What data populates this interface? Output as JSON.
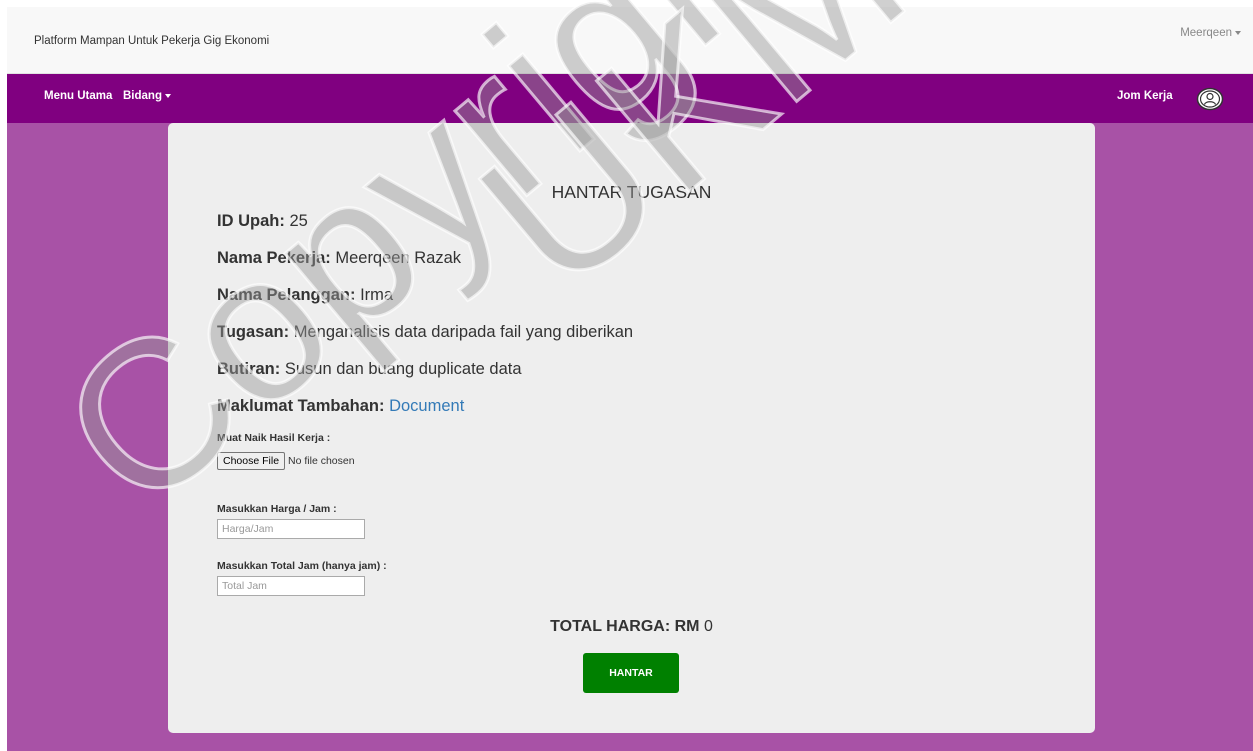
{
  "header": {
    "brand": "Platform Mampan Untuk Pekerja Gig Ekonomi",
    "user_menu": "Meerqeen"
  },
  "nav": {
    "menu_utama": "Menu Utama",
    "bidang": "Bidang",
    "jom_kerja": "Jom Kerja",
    "profile_icon": "user-circle-icon"
  },
  "colors": {
    "navbar": "#800080",
    "page_background": "#a852a6",
    "submit_button": "#008000",
    "link": "#337ab7"
  },
  "form": {
    "title": "HANTAR TUGASAN",
    "id_upah_label": "ID Upah:",
    "id_upah_value": "25",
    "nama_pekerja_label": "Nama Pekerja:",
    "nama_pekerja_value": "Meerqeen Razak",
    "nama_pelanggan_label": "Nama Pelanggan:",
    "nama_pelanggan_value": "Irma",
    "tugasan_label": "Tugasan:",
    "tugasan_value": "Menganalisis data daripada fail yang diberikan",
    "butiran_label": "Butiran:",
    "butiran_value": "Susun dan buang duplicate data",
    "maklumat_label": "Maklumat Tambahan:",
    "maklumat_link": "Document",
    "upload_label": "Muat Naik Hasil Kerja :",
    "choose_file": "Choose File",
    "file_status": "No file chosen",
    "harga_label": "Masukkan Harga / Jam :",
    "harga_placeholder": "Harga/Jam",
    "total_jam_label": "Masukkan Total Jam (hanya jam) :",
    "total_jam_placeholder": "Total Jam",
    "total_label": "TOTAL HARGA: RM",
    "total_value": "0",
    "submit": "HANTAR"
  },
  "watermark": {
    "text_1": "Copyright",
    "text_2": "UKM"
  }
}
